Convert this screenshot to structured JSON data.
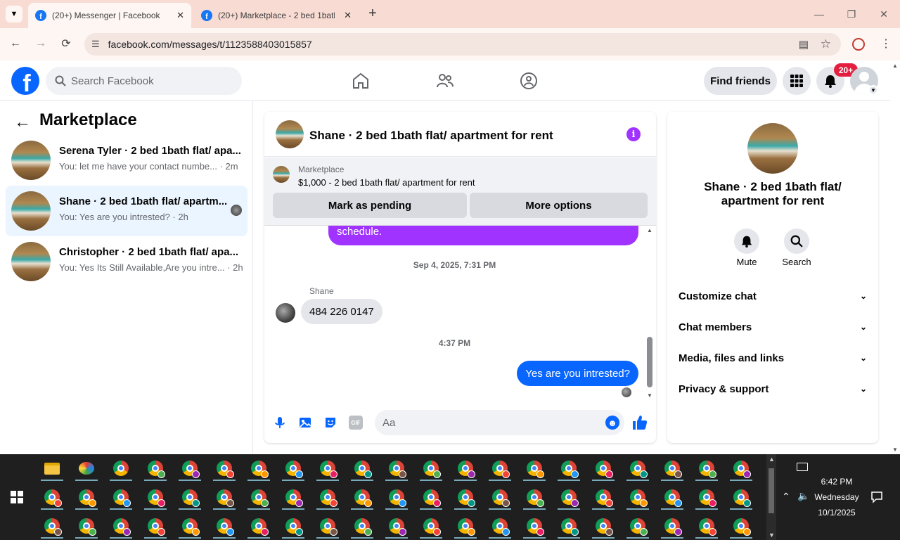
{
  "browser": {
    "tabs": [
      {
        "title": "(20+) Messenger | Facebook",
        "active": true
      },
      {
        "title": "(20+) Marketplace - 2 bed 1bath",
        "active": false
      }
    ],
    "url": "facebook.com/messages/t/1123588403015857"
  },
  "fb": {
    "logo": "f",
    "search_placeholder": "Search Facebook",
    "find_friends": "Find friends",
    "notif_badge": "20+"
  },
  "left": {
    "title": "Marketplace",
    "conversations": [
      {
        "title": "Serena Tyler · 2 bed 1bath flat/ apa...",
        "preview": "You: let me have your contact numbe... · 2m",
        "selected": false
      },
      {
        "title": "Shane · 2 bed 1bath flat/ apartm...",
        "preview": "You: Yes are you intrested? · 2h",
        "selected": true
      },
      {
        "title": "Christopher · 2 bed 1bath flat/ apa...",
        "preview": "You: Yes Its Still Available,Are you intre... · 2h",
        "selected": false
      }
    ]
  },
  "chat": {
    "title": "Shane · 2 bed 1bath flat/ apartment for rent",
    "listing_label": "Marketplace",
    "listing_detail": "$1,000 - 2 bed 1bath flat/ apartment for rent",
    "mark_pending": "Mark as pending",
    "more_options": "More options",
    "prev_msg_tail": "schedule.",
    "ts1": "Sep 4, 2025, 7:31 PM",
    "sender_name": "Shane",
    "incoming": "484 226 0147",
    "ts2": "4:37 PM",
    "outgoing": "Yes are you intrested?",
    "composer_placeholder": "Aa",
    "gif": "GIF"
  },
  "right": {
    "name": "Shane · 2 bed 1bath flat/ apartment for rent",
    "mute": "Mute",
    "search": "Search",
    "sections": [
      "Customize chat",
      "Chat members",
      "Media, files and links",
      "Privacy & support"
    ]
  },
  "taskbar": {
    "time": "6:42 PM",
    "day": "Wednesday",
    "date": "10/1/2025"
  },
  "colors": {
    "fb_blue": "#0866ff",
    "purple": "#a033ff",
    "badge_red": "#e41e3f"
  }
}
